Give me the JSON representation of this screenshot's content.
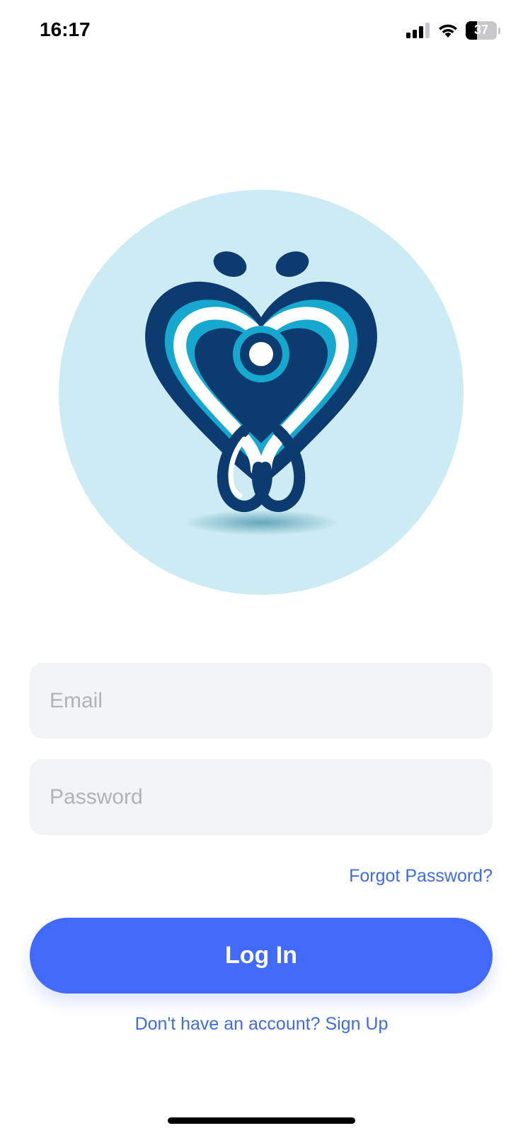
{
  "status_bar": {
    "time": "16:17",
    "battery_percent": "37",
    "battery_level": 0.37,
    "icons": [
      "signal-icon",
      "wifi-icon",
      "battery-icon"
    ]
  },
  "logo": {
    "name": "heart-stethoscope-logo",
    "colors": {
      "circle_bg": "#cdebf2",
      "navy": "#0b3b6f",
      "cyan": "#17a8cf",
      "white": "#ffffff"
    }
  },
  "form": {
    "email_placeholder": "Email",
    "password_placeholder": "Password",
    "forgot_label": "Forgot Password?",
    "login_label": "Log In",
    "signup_label": "Don't have an account? Sign Up"
  },
  "colors": {
    "accent": "#4169fa",
    "link": "#3f6bde",
    "field_bg": "#f2f3f5",
    "placeholder": "#b0b3b8"
  }
}
